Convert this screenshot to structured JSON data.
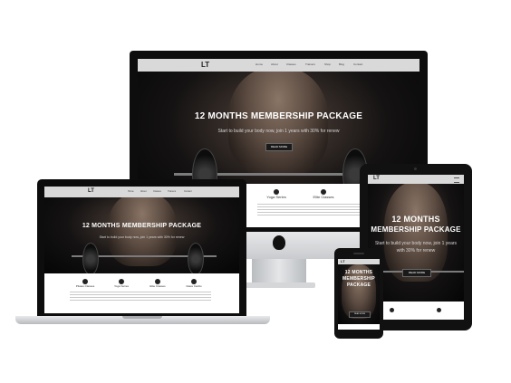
{
  "logo_text": "LT",
  "hero": {
    "title": "12 MONTHS MEMBERSHIP PACKAGE",
    "title_line1": "12 MONTHS",
    "title_line2": "MEMBERSHIP PACKAGE",
    "title_m1": "12 MONTHS",
    "title_m2": "MEMBERSHIP",
    "title_m3": "PACKAGE",
    "subtitle": "Start to build your body now, join 1 years with 30% for renew",
    "subtitle_short": "Start to build your body now, join 1 years with 30% for renew",
    "button": "READ MORE"
  },
  "menu": [
    "Home",
    "About",
    "Classes",
    "Trainers",
    "Shop",
    "Blog",
    "Contact"
  ],
  "features": [
    {
      "title": "Pilates Classes"
    },
    {
      "title": "Yoga Series"
    },
    {
      "title": "Elite Classes"
    },
    {
      "title": "Glass Cardio"
    }
  ],
  "colors": {
    "nav": "#d9d9d9",
    "hero_dark": "#050505",
    "device_black": "#111111",
    "silver": "#d4d6d8"
  }
}
